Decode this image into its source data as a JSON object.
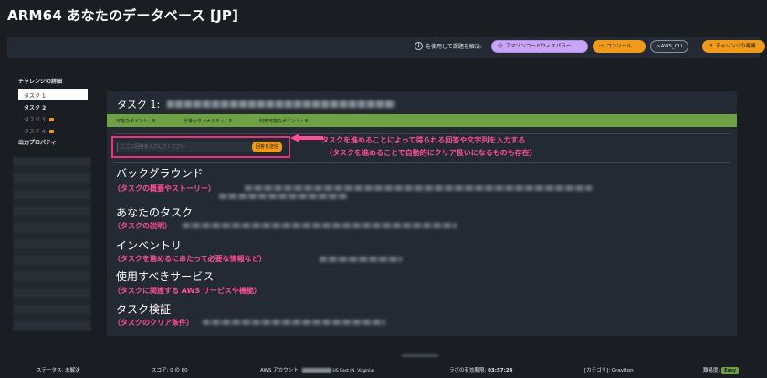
{
  "app": {
    "title": "ARM64 あなたのデータベース [JP]"
  },
  "toolbar": {
    "info_text": "を使用して課題を解決:",
    "wizard_label": "アマゾンコードウィスパラー",
    "console_label": "コンソール",
    "cli_label": ">AWS_CLI",
    "challenge_label": "チャレンジの再開"
  },
  "sidebar": {
    "heading": "チャレンジの詳細",
    "items": [
      {
        "label": "タスク 1"
      },
      {
        "label": "タスク 2"
      },
      {
        "label": "タスク 3"
      },
      {
        "label": "タスク 4"
      }
    ],
    "output_heading": "出力プロパティ"
  },
  "task": {
    "title": "タスク 1:",
    "points": {
      "available": "可能なポイント：8",
      "hint_penalty": "手掛かりペナルティ：0",
      "usable": "利用可能なポイント：8"
    },
    "answer_placeholder": "ここに回答を入力してください",
    "submit_label": "回答を送信"
  },
  "callouts": {
    "line1": "タスクを進めることによって得られる回答や文字列を入力する",
    "line2": "（タスクを進めることで自動的にクリア扱いになるものも存在）"
  },
  "sections": [
    {
      "heading": "バックグラウンド",
      "annotation": "（タスクの概要やストーリー）"
    },
    {
      "heading": "あなたのタスク",
      "annotation": "（タスクの説明）"
    },
    {
      "heading": "インベントリ",
      "annotation": "（タスクを進めるにあたって必要な情報など）"
    },
    {
      "heading": "使用すべきサービス",
      "annotation": "（タスクに関連する AWS サービスや機能）"
    },
    {
      "heading": "タスク検証",
      "annotation": "（タスクのクリア条件）"
    }
  ],
  "statusbar": {
    "status": "ステータス: 未解決",
    "score": "スコア: 0 の 80",
    "aws_account_label": "AWS アカウント:",
    "region": "US East (N. Virginia)",
    "lab_expiry_label": "ラボの有効期限:",
    "lab_expiry_value": "03:57:24",
    "category": "[カテゴリ]: Graviton",
    "difficulty_label": "難易度:",
    "difficulty_value": "Easy"
  },
  "colors": {
    "accent_orange": "#f09a1a",
    "annotation_pink": "#ff4f9a",
    "points_green": "#6ea144",
    "wizard_purple": "#c9a5f7"
  }
}
